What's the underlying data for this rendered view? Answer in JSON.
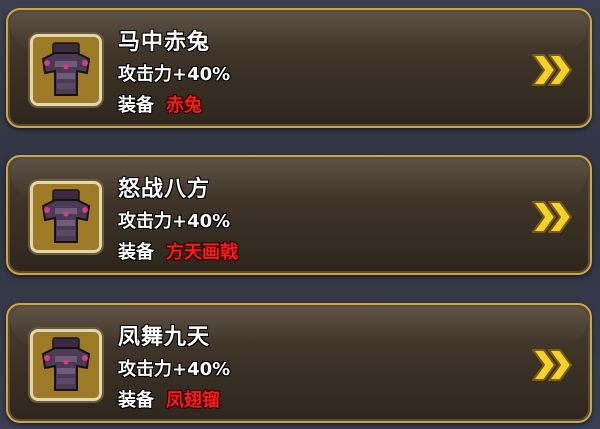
{
  "cards": [
    {
      "icon": "armor-icon",
      "title": "马中赤兔",
      "stat": "攻击力+40%",
      "equip_label": "装备",
      "equip_value": "赤兔"
    },
    {
      "icon": "armor-icon",
      "title": "怒战八方",
      "stat": "攻击力+40%",
      "equip_label": "装备",
      "equip_value": "方天画戟"
    },
    {
      "icon": "armor-icon",
      "title": "凤舞九天",
      "stat": "攻击力+40%",
      "equip_label": "装备",
      "equip_value": "凤翅镏"
    }
  ],
  "colors": {
    "border": "#c9a64a",
    "equip_value": "#ff1a1a",
    "arrow": "#f5d22a"
  }
}
